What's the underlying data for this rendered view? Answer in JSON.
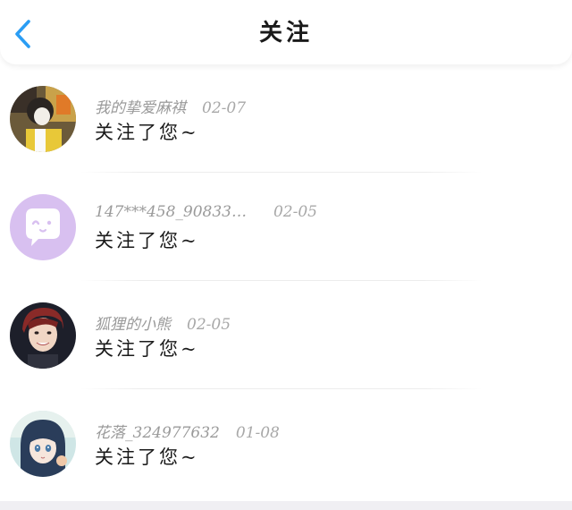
{
  "header": {
    "title": "关注",
    "back_icon": "chevron-left-icon",
    "accent_color": "#2a9df4"
  },
  "items": [
    {
      "name": "我的挚爱麻祺",
      "date": "02-07",
      "message": "关注了您~",
      "avatar": "photo-avatar"
    },
    {
      "name": "147***458_90833…",
      "date": "02-05",
      "message": "关注了您~",
      "avatar": "default-chat-avatar",
      "avatar_color": "#d8c0f0"
    },
    {
      "name": "狐狸的小熊",
      "date": "02-05",
      "message": "关注了您~",
      "avatar": "photo-avatar"
    },
    {
      "name": "花落_324977632",
      "date": "01-08",
      "message": "关注了您~",
      "avatar": "anime-avatar"
    }
  ]
}
